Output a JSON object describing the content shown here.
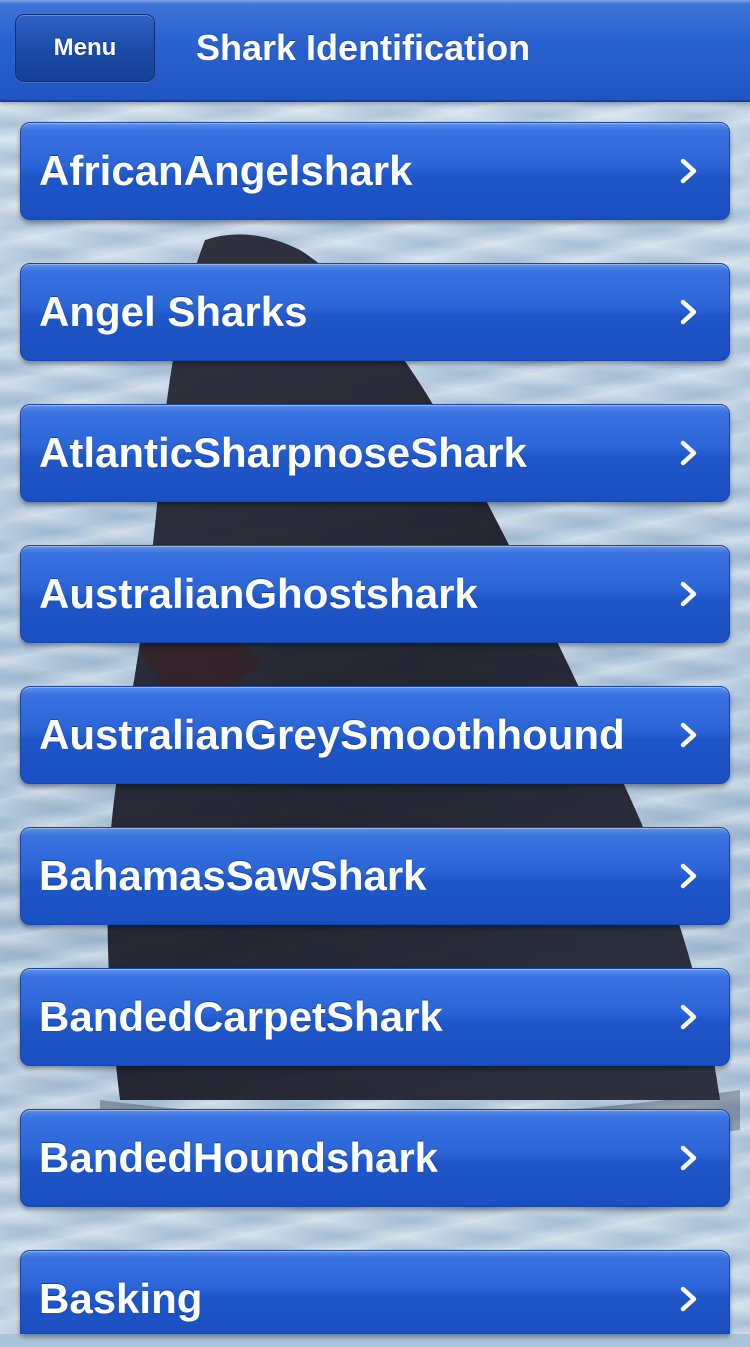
{
  "header": {
    "menu_label": "Menu",
    "title": "Shark Identification"
  },
  "list": {
    "items": [
      {
        "label": "AfricanAngelshark"
      },
      {
        "label": "Angel Sharks"
      },
      {
        "label": "AtlanticSharpnoseShark"
      },
      {
        "label": "AustralianGhostshark"
      },
      {
        "label": "AustralianGreySmoothhound"
      },
      {
        "label": "BahamasSawShark"
      },
      {
        "label": "BandedCarpetShark"
      },
      {
        "label": "BandedHoundshark"
      },
      {
        "label": "Basking"
      }
    ]
  },
  "colors": {
    "header_blue": "#2a62cf",
    "row_blue": "#2a64d6",
    "text": "#ffffff"
  },
  "icons": {
    "row_chevron": "chevron-right-icon"
  }
}
